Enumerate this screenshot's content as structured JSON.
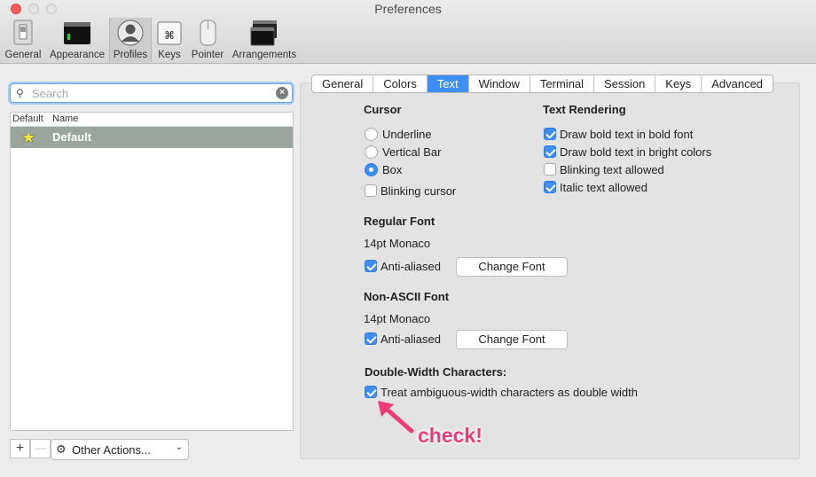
{
  "window": {
    "title": "Preferences"
  },
  "toolbar": {
    "items": [
      {
        "label": "General",
        "icon": "general-switch-icon"
      },
      {
        "label": "Appearance",
        "icon": "appearance-window-icon"
      },
      {
        "label": "Profiles",
        "icon": "profiles-person-icon",
        "active": true
      },
      {
        "label": "Keys",
        "icon": "keys-command-icon"
      },
      {
        "label": "Pointer",
        "icon": "pointer-mouse-icon"
      },
      {
        "label": "Arrangements",
        "icon": "arrangements-windows-icon"
      }
    ]
  },
  "search": {
    "placeholder": "Search"
  },
  "profiles": {
    "headers": [
      "Default",
      "Name"
    ],
    "rows": [
      {
        "name": "Default",
        "is_default": true
      }
    ]
  },
  "bottom": {
    "add": "+",
    "remove": "—",
    "other_actions": "Other Actions..."
  },
  "tabs": [
    "General",
    "Colors",
    "Text",
    "Window",
    "Terminal",
    "Session",
    "Keys",
    "Advanced"
  ],
  "selected_tab": "Text",
  "cursor": {
    "heading": "Cursor",
    "options": [
      "Underline",
      "Vertical Bar",
      "Box"
    ],
    "selected": "Box",
    "blinking_label": "Blinking cursor",
    "blinking_checked": false
  },
  "text_rendering": {
    "heading": "Text Rendering",
    "options": [
      {
        "label": "Draw bold text in bold font",
        "checked": true
      },
      {
        "label": "Draw bold text in bright colors",
        "checked": true
      },
      {
        "label": "Blinking text allowed",
        "checked": false
      },
      {
        "label": "Italic text allowed",
        "checked": true
      }
    ]
  },
  "regular_font": {
    "heading": "Regular Font",
    "font": "14pt Monaco",
    "antialias_label": "Anti-aliased",
    "antialias_checked": true,
    "change_label": "Change Font"
  },
  "non_ascii_font": {
    "heading": "Non-ASCII Font",
    "font": "14pt Monaco",
    "antialias_label": "Anti-aliased",
    "antialias_checked": true,
    "change_label": "Change Font"
  },
  "double_width": {
    "heading": "Double-Width Characters:",
    "label": "Treat ambiguous-width characters as double width",
    "checked": true
  },
  "annotation": {
    "text": "check!",
    "color": "#ee3a78"
  },
  "colors": {
    "accent": "#3d8ef6",
    "selected_row": "#9aa59e"
  }
}
